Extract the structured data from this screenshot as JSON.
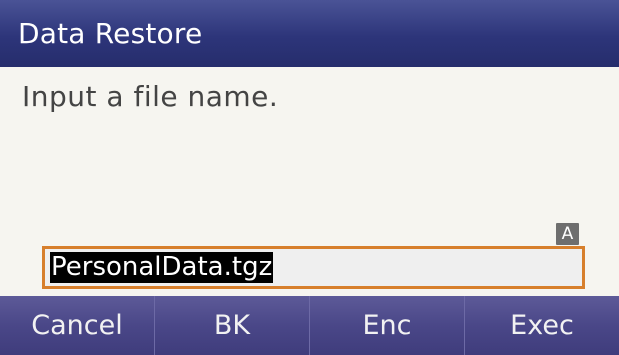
{
  "header": {
    "title": "Data Restore"
  },
  "body": {
    "prompt": "Input a file name.",
    "input_mode": "A",
    "filename_value": "PersonalData.tgz"
  },
  "softkeys": [
    {
      "label": "Cancel"
    },
    {
      "label": "BK"
    },
    {
      "label": "Enc"
    },
    {
      "label": "Exec"
    }
  ]
}
